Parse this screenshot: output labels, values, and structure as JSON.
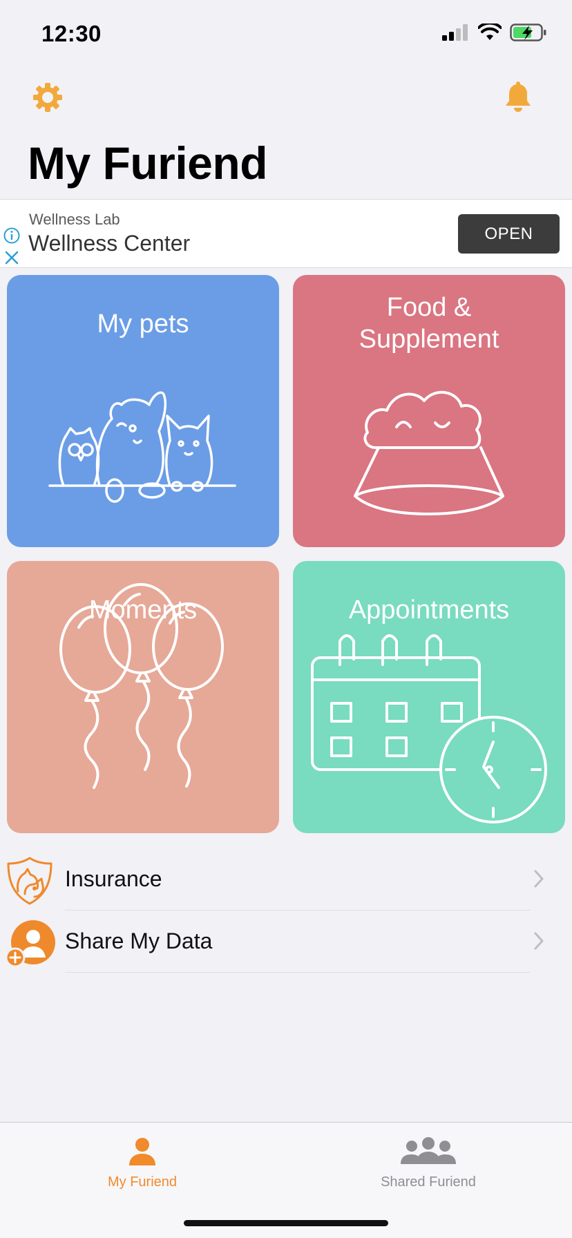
{
  "status_bar": {
    "time": "12:30"
  },
  "header": {
    "title": "My Furiend",
    "settings_icon": "gear-icon",
    "notifications_icon": "bell-icon",
    "accent_color": "#f2a93b"
  },
  "ad": {
    "advertiser": "Wellness Lab",
    "title": "Wellness Center",
    "button_label": "OPEN"
  },
  "tiles": [
    {
      "label": "My pets",
      "color": "#6b9de6",
      "icon": "pets-illustration"
    },
    {
      "label": "Food & Supplement",
      "color": "#da7582",
      "icon": "food-bowl-illustration"
    },
    {
      "label": "Moments",
      "color": "#e6a897",
      "icon": "balloons-illustration"
    },
    {
      "label": "Appointments",
      "color": "#79dbbf",
      "icon": "calendar-clock-illustration"
    }
  ],
  "list": [
    {
      "label": "Insurance",
      "icon": "insurance-shield-icon"
    },
    {
      "label": "Share My Data",
      "icon": "share-user-icon"
    }
  ],
  "tab_bar": {
    "tabs": [
      {
        "label": "My Furiend",
        "icon": "person-icon",
        "active": true
      },
      {
        "label": "Shared Furiend",
        "icon": "group-icon",
        "active": false
      }
    ],
    "active_color": "#f08a2b",
    "inactive_color": "#8e8e93"
  }
}
